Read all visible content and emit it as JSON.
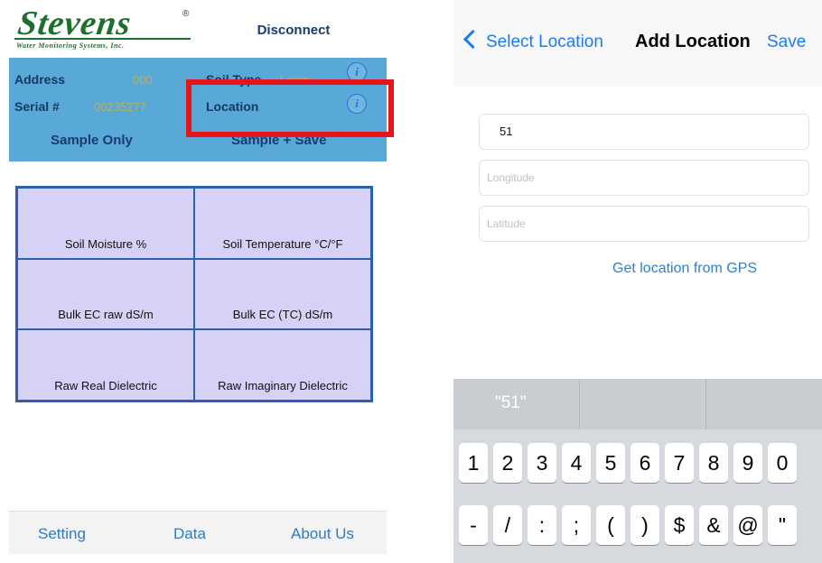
{
  "left": {
    "logo": {
      "wordmark": "Stevens",
      "registered": "®",
      "subtitle": "Water Monitoring Systems, Inc."
    },
    "disconnect_label": "Disconnect",
    "info": {
      "address_label": "Address",
      "address_value": "000",
      "soil_type_label": "Soil Type",
      "soil_type_value": "Loam",
      "serial_label": "Serial #",
      "serial_value": "00235277",
      "location_label": "Location",
      "info_glyph": "i"
    },
    "sample_only_label": "Sample Only",
    "sample_save_label": "Sample + Save",
    "grid": [
      "Soil Moisture %",
      "Soil Temperature °C/°F",
      "Bulk EC raw dS/m",
      "Bulk EC (TC) dS/m",
      "Raw Real Dielectric",
      "Raw Imaginary Dielectric"
    ],
    "tabs": {
      "setting": "Setting",
      "data": "Data",
      "about": "About Us"
    }
  },
  "right": {
    "nav": {
      "back_label": "Select Location",
      "title": "Add Location",
      "save_label": "Save"
    },
    "name_value": "51",
    "longitude_placeholder": "Longitude",
    "latitude_placeholder": "Latitude",
    "gps_label": "Get location from GPS",
    "keyboard": {
      "suggestion": "\"51\"",
      "row1": [
        "1",
        "2",
        "3",
        "4",
        "5",
        "6",
        "7",
        "8",
        "9",
        "0"
      ],
      "row2": [
        "-",
        "/",
        ":",
        ";",
        "(",
        ")",
        "$",
        "&",
        "@",
        "\""
      ]
    }
  },
  "colors": {
    "panel_blue": "#58a8d8",
    "grid_fill": "#d5d1f7",
    "highlight_red": "#e8141c",
    "ios_blue": "#1a7cf5",
    "logo_green": "#1d6f2b"
  }
}
